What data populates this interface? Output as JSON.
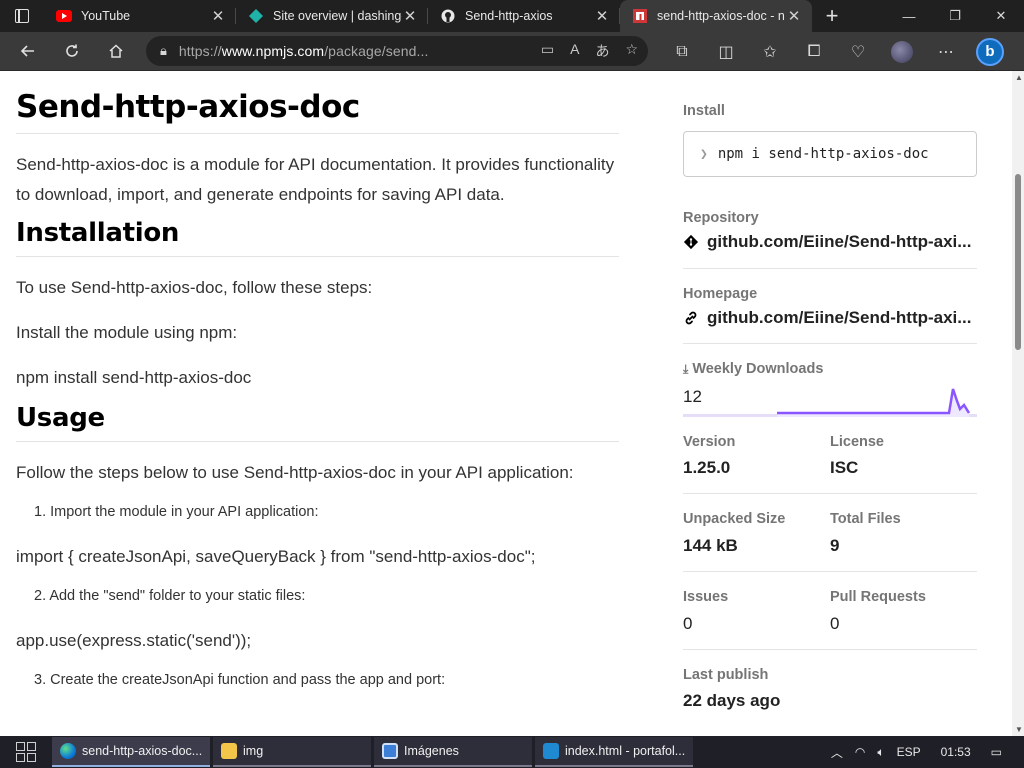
{
  "browser": {
    "tabs": [
      {
        "title": "YouTube",
        "icon": "youtube-icon",
        "active": false
      },
      {
        "title": "Site overview | dashing-",
        "icon": "netlify-icon",
        "active": false
      },
      {
        "title": "Send-http-axios",
        "icon": "github-icon",
        "active": false
      },
      {
        "title": "send-http-axios-doc - n",
        "icon": "npm-icon",
        "active": true
      }
    ],
    "new_tab": "+",
    "url_prefix": "https://",
    "url_host": "www.npmjs.com",
    "url_path": "/package/send..."
  },
  "readme": {
    "title": "Send-http-axios-doc",
    "intro": "Send-http-axios-doc is a module for API documentation. It provides functionality to download, import, and generate endpoints for saving API data.",
    "installation_heading": "Installation",
    "installation_p1": "To use Send-http-axios-doc, follow these steps:",
    "installation_p2": "Install the module using npm:",
    "installation_p3": "npm install send-http-axios-doc",
    "usage_heading": "Usage",
    "usage_p1": "Follow the steps below to use Send-http-axios-doc in your API application:",
    "step1": "1. Import the module in your API application:",
    "code1": "import { createJsonApi, saveQueryBack } from \"send-http-axios-doc\";",
    "step2": "2. Add the \"send\" folder to your static files:",
    "code2": "app.use(express.static('send'));",
    "step3": "3. Create the createJsonApi function and pass the app and port:"
  },
  "sidebar": {
    "install_label": "Install",
    "install_cmd": "npm i send-http-axios-doc",
    "repository_label": "Repository",
    "repository_value": "github.com/Eiine/Send-http-axi...",
    "homepage_label": "Homepage",
    "homepage_value": "github.com/Eiine/Send-http-axi...",
    "weekly_downloads_label": "Weekly Downloads",
    "weekly_downloads_value": "12",
    "version_label": "Version",
    "version_value": "1.25.0",
    "license_label": "License",
    "license_value": "ISC",
    "unpacked_size_label": "Unpacked Size",
    "unpacked_size_value": "144 kB",
    "total_files_label": "Total Files",
    "total_files_value": "9",
    "issues_label": "Issues",
    "issues_value": "0",
    "pull_requests_label": "Pull Requests",
    "pull_requests_value": "0",
    "last_publish_label": "Last publish",
    "last_publish_value": "22 days ago"
  },
  "taskbar": {
    "items": [
      {
        "label": "send-http-axios-doc...",
        "icon": "edge-icon"
      },
      {
        "label": "img",
        "icon": "folder-icon"
      },
      {
        "label": "Imágenes",
        "icon": "image-viewer-icon"
      },
      {
        "label": "index.html - portafol...",
        "icon": "vscode-icon"
      }
    ],
    "language": "ESP",
    "time": "01:53"
  },
  "colors": {
    "npm_red": "#cb3837",
    "sparkline": "#8956ff"
  }
}
